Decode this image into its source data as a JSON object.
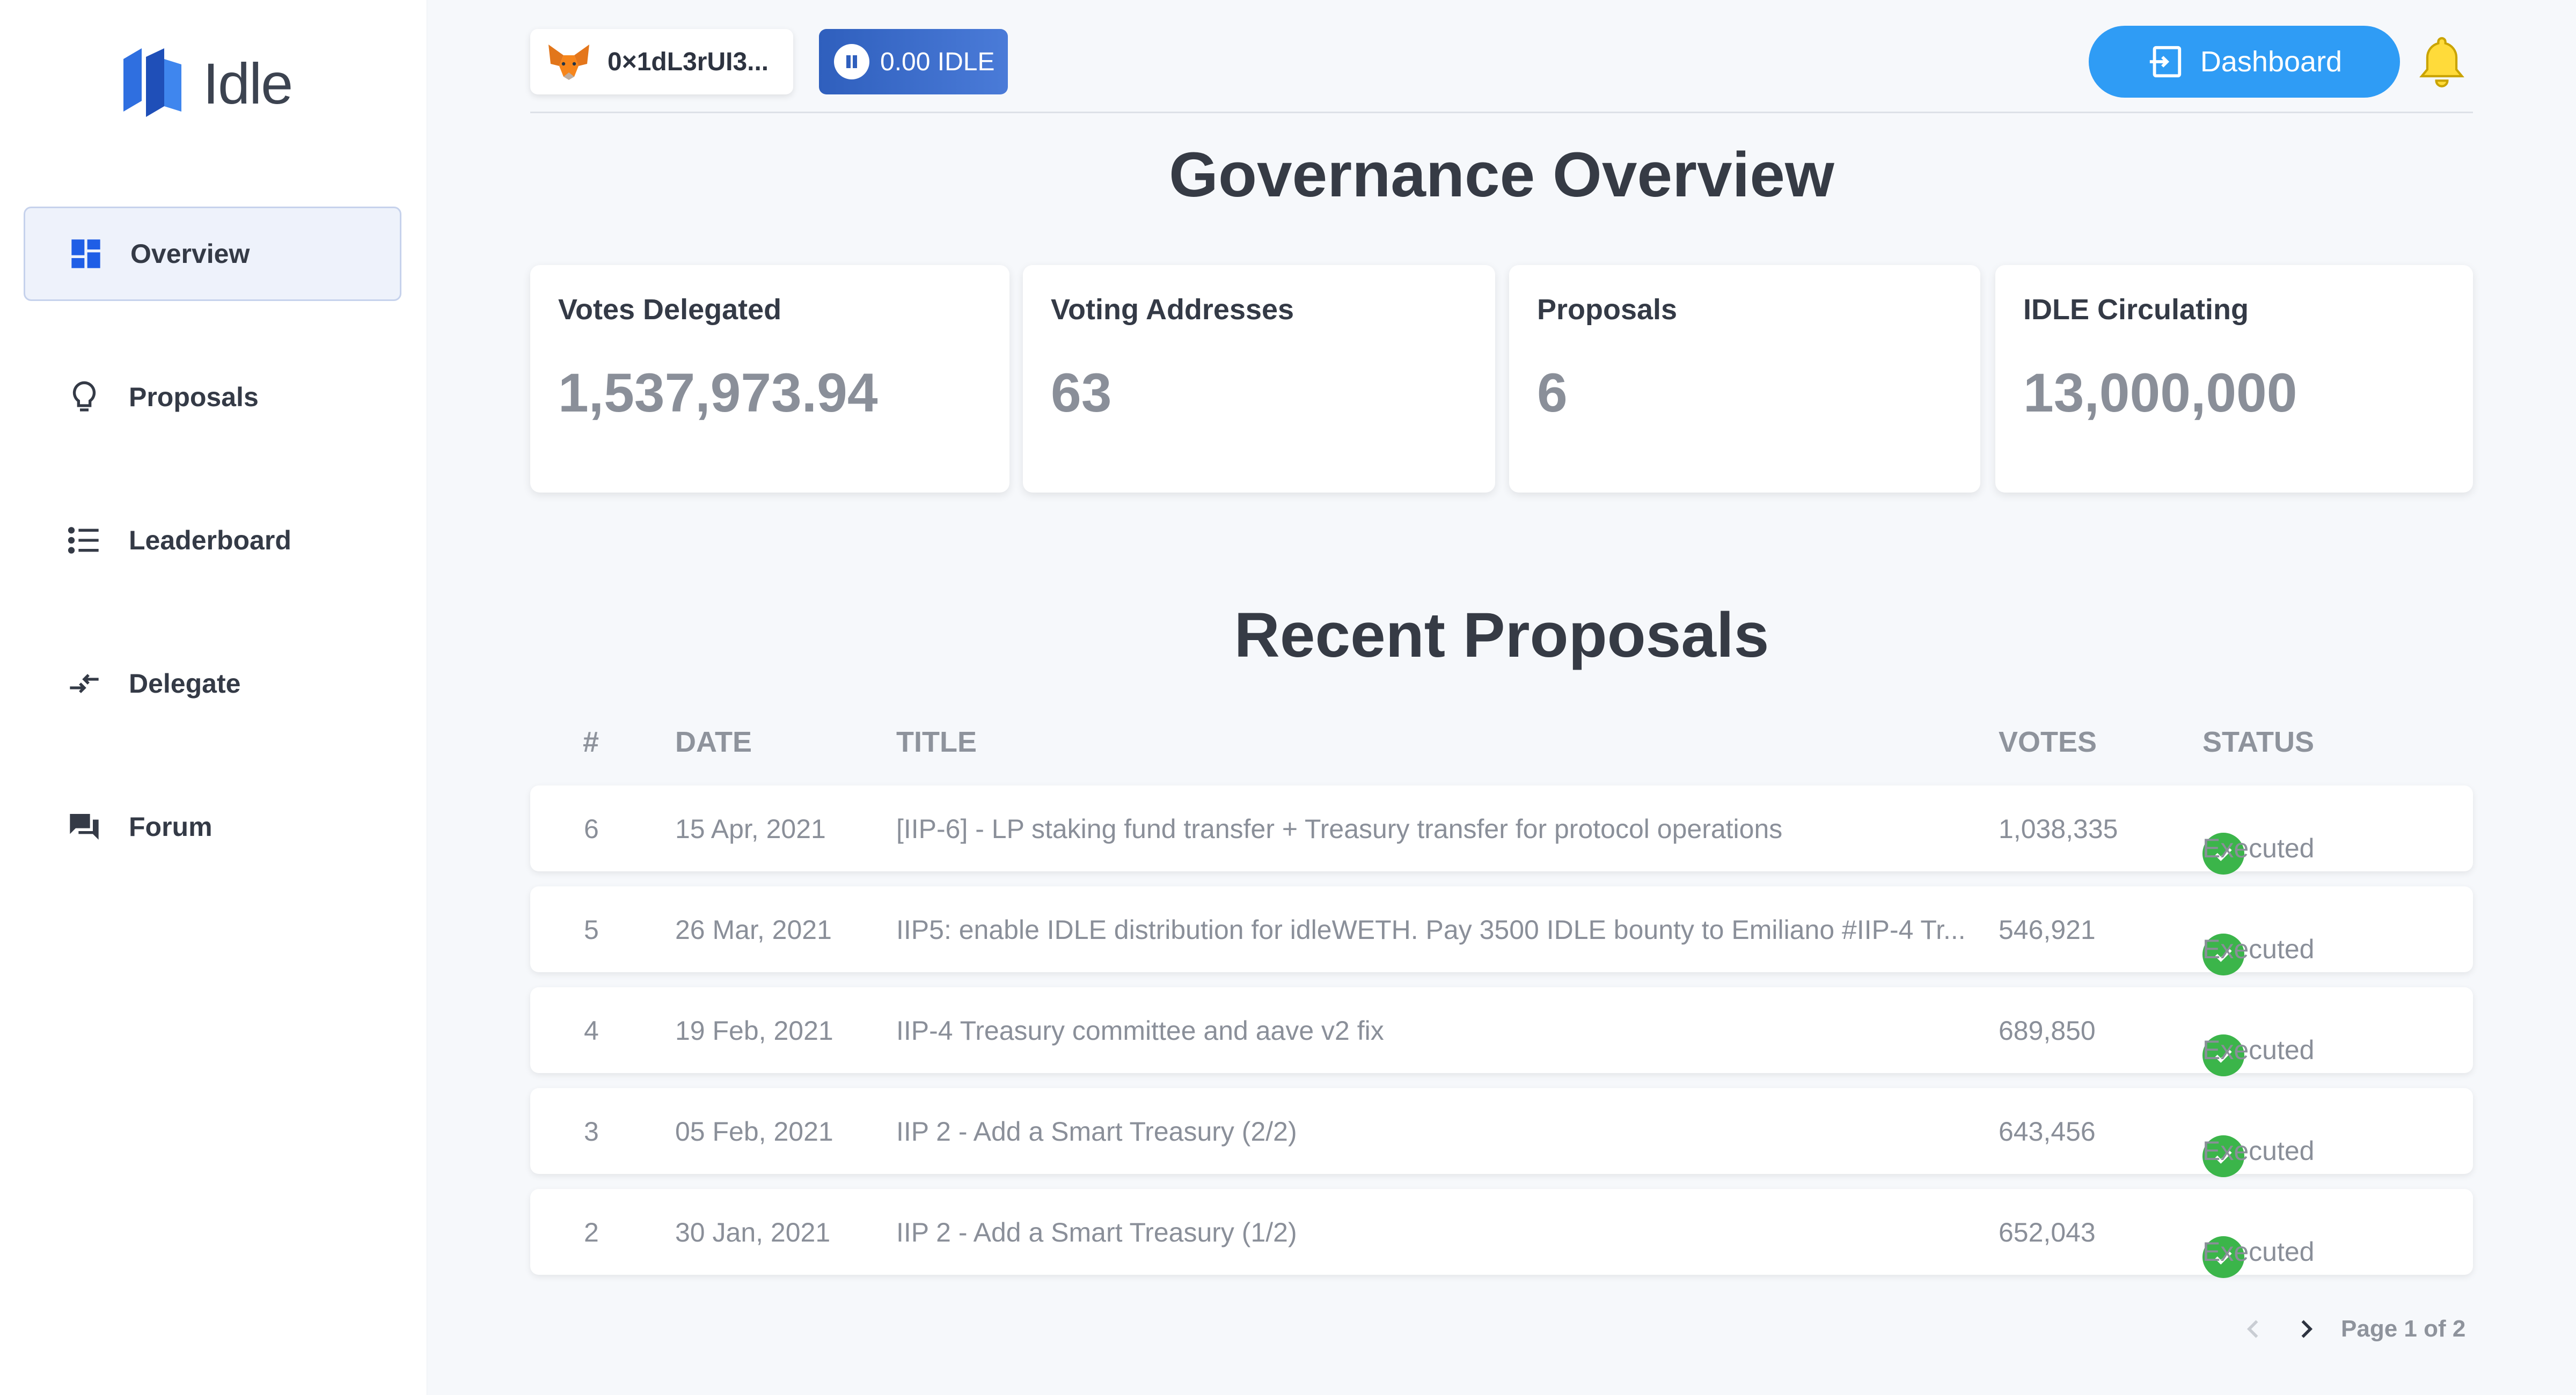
{
  "sidebar": {
    "logo_text": "Idle",
    "items": [
      {
        "label": "Overview",
        "icon": "dashboard-grid-icon",
        "active": true
      },
      {
        "label": "Proposals",
        "icon": "lightbulb-icon",
        "active": false
      },
      {
        "label": "Leaderboard",
        "icon": "numbered-list-icon",
        "active": false
      },
      {
        "label": "Delegate",
        "icon": "swap-arrows-icon",
        "active": false
      },
      {
        "label": "Forum",
        "icon": "chat-bubbles-icon",
        "active": false
      }
    ]
  },
  "header": {
    "wallet_address": "0×1dL3rUI3...",
    "balance": "0.00 IDLE",
    "dashboard_label": "Dashboard"
  },
  "overview": {
    "title": "Governance Overview",
    "stats": [
      {
        "label": "Votes Delegated",
        "value": "1,537,973.94"
      },
      {
        "label": "Voting Addresses",
        "value": "63"
      },
      {
        "label": "Proposals",
        "value": "6"
      },
      {
        "label": "IDLE Circulating",
        "value": "13,000,000"
      }
    ]
  },
  "proposals": {
    "title": "Recent Proposals",
    "columns": [
      "#",
      "DATE",
      "TITLE",
      "VOTES",
      "STATUS"
    ],
    "rows": [
      {
        "num": "6",
        "date": "15 Apr, 2021",
        "title": "[IIP-6] - LP staking fund transfer + Treasury transfer for protocol operations",
        "votes": "1,038,335",
        "status": "Executed"
      },
      {
        "num": "5",
        "date": "26 Mar, 2021",
        "title": "IIP5: enable IDLE distribution for idleWETH. Pay 3500 IDLE bounty to Emiliano #IIP-4 Tr...",
        "votes": "546,921",
        "status": "Executed"
      },
      {
        "num": "4",
        "date": "19 Feb, 2021",
        "title": "IIP-4 Treasury committee and aave v2 fix",
        "votes": "689,850",
        "status": "Executed"
      },
      {
        "num": "3",
        "date": "05 Feb, 2021",
        "title": "IIP 2 - Add a Smart Treasury (2/2)",
        "votes": "643,456",
        "status": "Executed"
      },
      {
        "num": "2",
        "date": "30 Jan, 2021",
        "title": "IIP 2 - Add a Smart Treasury (1/2)",
        "votes": "652,043",
        "status": "Executed"
      }
    ],
    "pagination": "Page 1 of 2"
  },
  "colors": {
    "accent": "#2f9cf5",
    "status_executed": "#3bb54a",
    "active_nav_bg": "#eef2fb"
  }
}
